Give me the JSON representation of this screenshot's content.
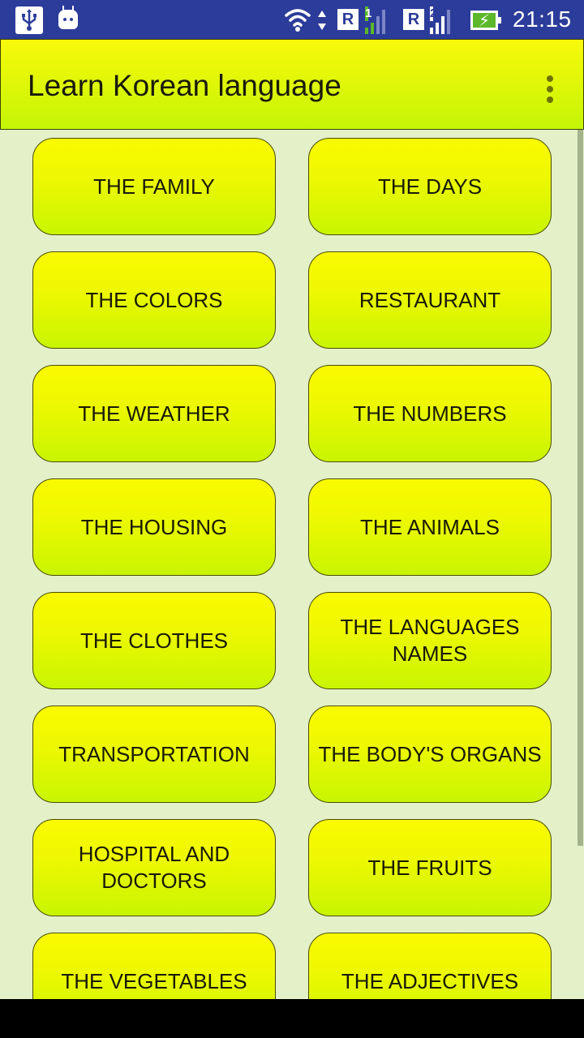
{
  "status_bar": {
    "icons": [
      "usb-icon",
      "android-icon",
      "wifi-icon",
      "data-arrows-icon",
      "roaming-icon",
      "signal-sim1-icon",
      "roaming-icon",
      "signal-sim2-icon",
      "battery-charging-icon"
    ],
    "roaming_label": "R",
    "sim1": "1",
    "sim2": "2",
    "time": "21:15"
  },
  "app_bar": {
    "title": "Learn Korean language",
    "menu_icon": "overflow-menu-icon"
  },
  "colors": {
    "status_bar": "#2c3c9a",
    "app_bar_top": "#f9f90a",
    "app_bar_bottom": "#c4f505",
    "background": "#e3f0c8",
    "button_top": "#fafa00",
    "button_bottom": "#c8f502"
  },
  "categories": [
    {
      "label": "THE FAMILY"
    },
    {
      "label": "THE DAYS"
    },
    {
      "label": "THE COLORS"
    },
    {
      "label": "RESTAURANT"
    },
    {
      "label": "THE WEATHER"
    },
    {
      "label": "THE NUMBERS"
    },
    {
      "label": "THE HOUSING"
    },
    {
      "label": "THE ANIMALS"
    },
    {
      "label": "THE CLOTHES"
    },
    {
      "label": "THE LANGUAGES NAMES"
    },
    {
      "label": "TRANSPORTATION"
    },
    {
      "label": "THE BODY'S ORGANS"
    },
    {
      "label": "HOSPITAL AND DOCTORS"
    },
    {
      "label": "THE FRUITS"
    },
    {
      "label": "THE VEGETABLES"
    },
    {
      "label": "THE ADJECTIVES"
    }
  ]
}
